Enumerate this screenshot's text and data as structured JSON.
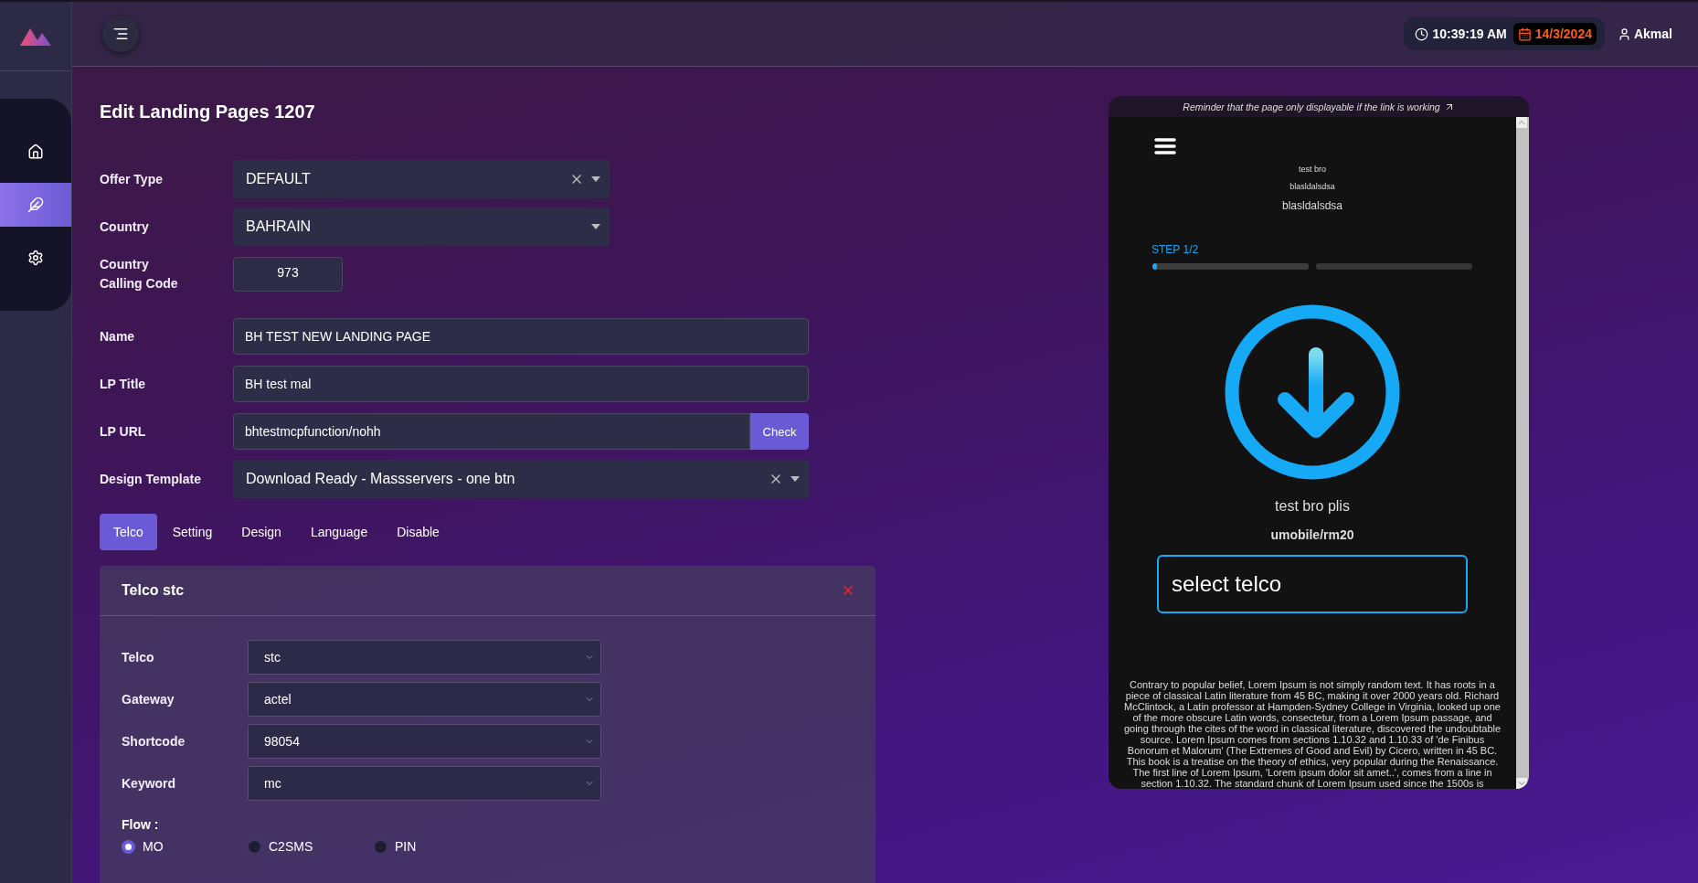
{
  "sidebar": {
    "items": [
      {
        "kind": "home",
        "selected": false
      },
      {
        "kind": "edit",
        "selected": true
      },
      {
        "kind": "settings",
        "selected": false
      }
    ]
  },
  "header": {
    "time": "10:39:19 AM",
    "date": "14/3/2024",
    "user": "Akmal"
  },
  "page_title": "Edit Landing Pages 1207",
  "form": {
    "fields": [
      {
        "label": "Offer Type",
        "kind": "select",
        "value": "DEFAULT",
        "clearable": true
      },
      {
        "label": "Country",
        "kind": "select",
        "value": "BAHRAIN"
      },
      {
        "label": "Country Calling Code",
        "kind": "short",
        "value": "973"
      },
      {
        "label": "Name",
        "kind": "text",
        "value": "BH TEST NEW LANDING PAGE"
      },
      {
        "label": "LP Title",
        "kind": "text",
        "value": "BH test mal"
      },
      {
        "label": "LP URL",
        "kind": "url",
        "value": "bhtestmcpfunction/nohh",
        "button": "Check"
      },
      {
        "label": "Design Template",
        "kind": "wide_select",
        "value": "Download Ready - Massservers - one btn",
        "clearable": true
      }
    ]
  },
  "tabs": [
    {
      "label": "Telco",
      "selected": true
    },
    {
      "label": "Setting",
      "selected": false
    },
    {
      "label": "Design",
      "selected": false
    },
    {
      "label": "Language",
      "selected": false
    },
    {
      "label": "Disable",
      "selected": false
    }
  ],
  "telco_panel": {
    "title": "Telco stc",
    "fields": [
      {
        "label": "Telco",
        "value": "stc"
      },
      {
        "label": "Gateway",
        "value": "actel"
      },
      {
        "label": "Shortcode",
        "value": "98054"
      },
      {
        "label": "Keyword",
        "value": "mc"
      }
    ],
    "flow_label": "Flow :",
    "flow_options": [
      {
        "label": "MO",
        "selected": true
      },
      {
        "label": "C2SMS",
        "selected": false
      },
      {
        "label": "PIN",
        "selected": false
      }
    ]
  },
  "preview": {
    "reminder": "Reminder that the page only displayable if the link is working",
    "lines": [
      "test bro",
      "blasldalsdsa"
    ],
    "subtitle": "blasldalsdsa",
    "step": "STEP 1/2",
    "steps": [
      {
        "current": true,
        "level": 0.03
      },
      {
        "current": false
      }
    ],
    "caption": "test bro plis",
    "code": "umobile/rm20",
    "select_value": "select telco",
    "body": "Contrary to popular belief, Lorem Ipsum is not simply random text. It has roots in a piece of classical Latin literature from 45 BC, making it over 2000 years old. Richard McClintock, a Latin professor at Hampden-Sydney College in Virginia, looked up one of the more obscure Latin words, consectetur, from a Lorem Ipsum passage, and going through the cites of the word in classical literature, discovered the undoubtable source. Lorem Ipsum comes from sections 1.10.32 and 1.10.33 of 'de Finibus Bonorum et Malorum' (The Extremes of Good and Evil) by Cicero, written in 45 BC. This book is a treatise on the theory of ethics, very popular during the Renaissance. The first line of Lorem Ipsum, 'Lorem ipsum dolor sit amet..', comes from a line in section 1.10.32. The standard chunk of Lorem Ipsum used since the 1500s is"
  }
}
